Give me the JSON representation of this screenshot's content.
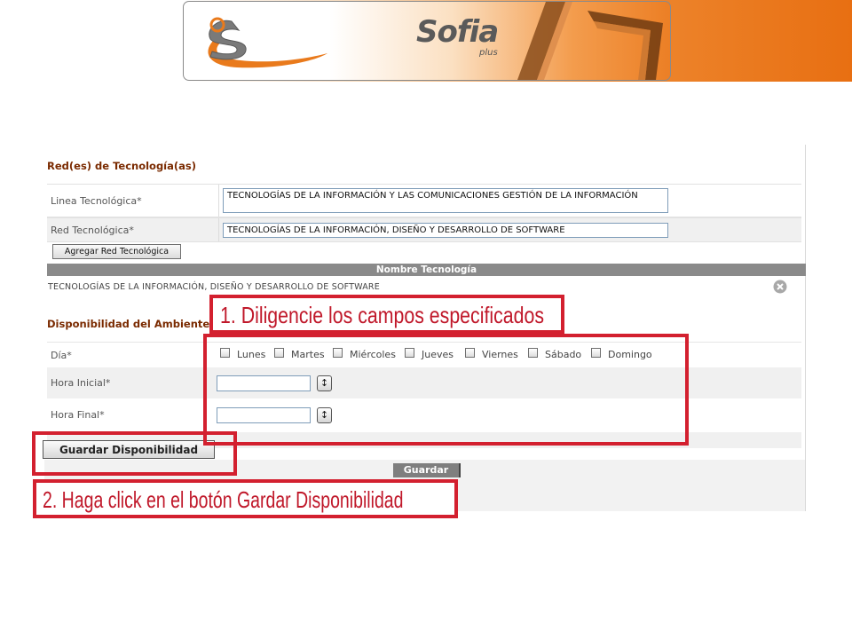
{
  "brand": {
    "logo_text": "Sofia",
    "logo_subtext": "plus"
  },
  "technology_section": {
    "title": "Red(es) de Tecnología(as)",
    "linea_label": "Linea Tecnológica*",
    "linea_value": "TECNOLOGÍAS DE LA INFORMACIÓN Y LAS COMUNICACIONES GESTIÓN DE LA INFORMACIÓN",
    "red_label": "Red Tecnológica*",
    "red_value": "TECNOLOGÍAS DE LA INFORMACIÓN, DISEÑO Y DESARROLLO DE SOFTWARE",
    "add_button": "Agregar Red Tecnológica",
    "table_header": "Nombre Tecnología",
    "table_row": "TECNOLOGÍAS DE LA INFORMACIÓN, DISEÑO Y DESARROLLO DE SOFTWARE",
    "remove_icon": "remove-circle-icon"
  },
  "availability_section": {
    "title": "Disponibilidad del Ambiente",
    "day_label": "Día*",
    "days": [
      "Lunes",
      "Martes",
      "Miércoles",
      "Jueves",
      "Viernes",
      "Sábado",
      "Domingo"
    ],
    "start_label": "Hora Inicial*",
    "end_label": "Hora Final*",
    "start_value": "",
    "end_value": "",
    "spinner_icon": "up-down-arrow-icon"
  },
  "buttons": {
    "save_availability": "Guardar Disponibilidad",
    "save": "Guardar"
  },
  "annotations": {
    "step1": "1. Diligencie los campos especificados",
    "step2": "2. Haga click en el botón Gardar Disponibilidad"
  },
  "colors": {
    "annotation_red": "#d3202f",
    "section_title": "#7a2a00",
    "banner_orange": "#e86f12"
  }
}
